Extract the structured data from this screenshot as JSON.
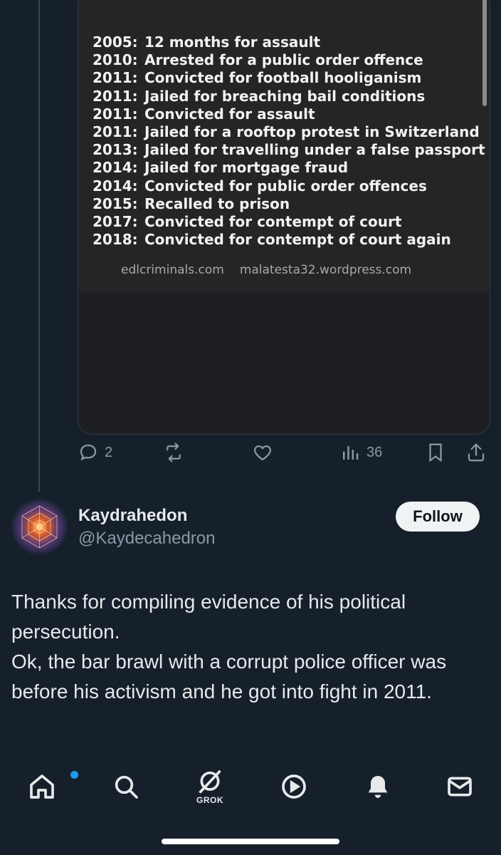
{
  "media": {
    "records": [
      {
        "year": "2005:",
        "text": "12 months for assault"
      },
      {
        "year": "2010:",
        "text": "Arrested for a public order offence"
      },
      {
        "year": "2011:",
        "text": "Convicted for football hooliganism"
      },
      {
        "year": "2011:",
        "text": "Jailed for breaching bail conditions"
      },
      {
        "year": "2011:",
        "text": "Convicted for assault"
      },
      {
        "year": "2011:",
        "text": "Jailed for a rooftop protest in Switzerland"
      },
      {
        "year": "2013:",
        "text": "Jailed for travelling under a false passport"
      },
      {
        "year": "2014:",
        "text": "Jailed for mortgage fraud"
      },
      {
        "year": "2014:",
        "text": "Convicted for public order offences"
      },
      {
        "year": "2015:",
        "text": "Recalled to prison"
      },
      {
        "year": "2017:",
        "text": "Convicted for contempt of court"
      },
      {
        "year": "2018:",
        "text": "Convicted for contempt of court again"
      }
    ],
    "source_1": "edlcriminals.com",
    "source_2": "malatesta32.wordpress.com"
  },
  "actions": {
    "reply_count": "2",
    "views_count": "36",
    "reply_icon": "reply-icon",
    "retweet_icon": "retweet-icon",
    "like_icon": "heart-icon",
    "views_icon": "views-icon",
    "bookmark_icon": "bookmark-icon",
    "share_icon": "share-icon"
  },
  "author": {
    "name": "Kaydrahedon",
    "handle": "@Kaydecahedron",
    "follow_label": "Follow"
  },
  "tweet": {
    "line1": "Thanks for compiling evidence of his political persecution.",
    "line2": "Ok, the bar brawl with a corrupt police officer was before his activism and he got into fight in 2011."
  },
  "nav": {
    "grok_label": "GROK",
    "accent": "#1d9bf0"
  }
}
